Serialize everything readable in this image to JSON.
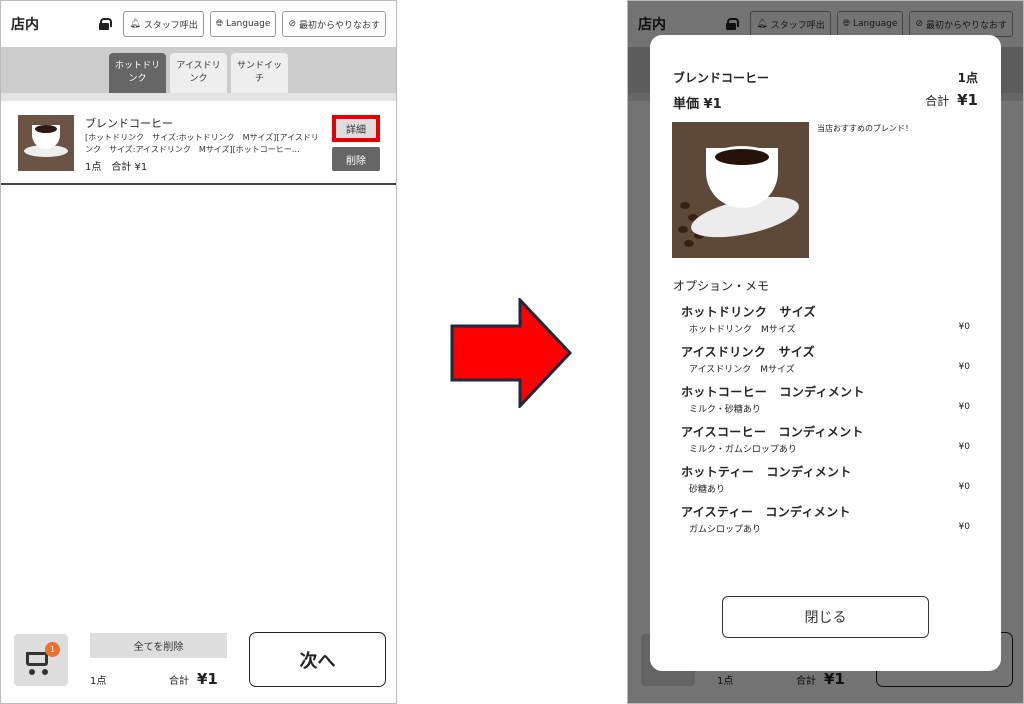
{
  "header": {
    "store_label": "店内",
    "staff_call": "スタッフ呼出",
    "language": "Language",
    "restart": "最初からやりなおす"
  },
  "tabs": [
    {
      "label": "ホットドリンク",
      "active": true
    },
    {
      "label": "アイスドリンク",
      "active": false
    },
    {
      "label": "サンドイッチ",
      "active": false
    }
  ],
  "cart_item": {
    "name": "ブレンドコーヒー",
    "description": "[ホットドリンク　サイズ:ホットドリンク　Mサイズ][アイスドリンク　サイズ:アイスドリンク　Mサイズ][ホットコーヒー…",
    "qty_total": "1点　合計 ¥1",
    "detail_button": "詳細",
    "delete_button": "削除"
  },
  "footer": {
    "cart_badge": "1",
    "clear_all": "全てを削除",
    "count": "1点",
    "total_label": "合計",
    "total_value": "¥1",
    "next_button": "次へ"
  },
  "modal": {
    "title": "ブレンドコーヒー",
    "qty": "1点",
    "unit_price": "単価 ¥1",
    "total_label": "合計",
    "total_value": "¥1",
    "note": "当店おすすめのブレンド！",
    "section": "オプション・メモ",
    "options": [
      {
        "name": "ホットドリンク　サイズ",
        "value": "ホットドリンク　Mサイズ",
        "price": "¥0"
      },
      {
        "name": "アイスドリンク　サイズ",
        "value": "アイスドリンク　Mサイズ",
        "price": "¥0"
      },
      {
        "name": "ホットコーヒー　コンディメント",
        "value": "ミルク・砂糖あり",
        "price": "¥0"
      },
      {
        "name": "アイスコーヒー　コンディメント",
        "value": "ミルク・ガムシロップあり",
        "price": "¥0"
      },
      {
        "name": "ホットティー　コンディメント",
        "value": "砂糖あり",
        "price": "¥0"
      },
      {
        "name": "アイスティー　コンディメント",
        "value": "ガムシロップあり",
        "price": "¥0"
      }
    ],
    "close_button": "閉じる"
  },
  "colors": {
    "highlight": "#e60000",
    "arrow": "#ff0000",
    "badge": "#f07030"
  }
}
